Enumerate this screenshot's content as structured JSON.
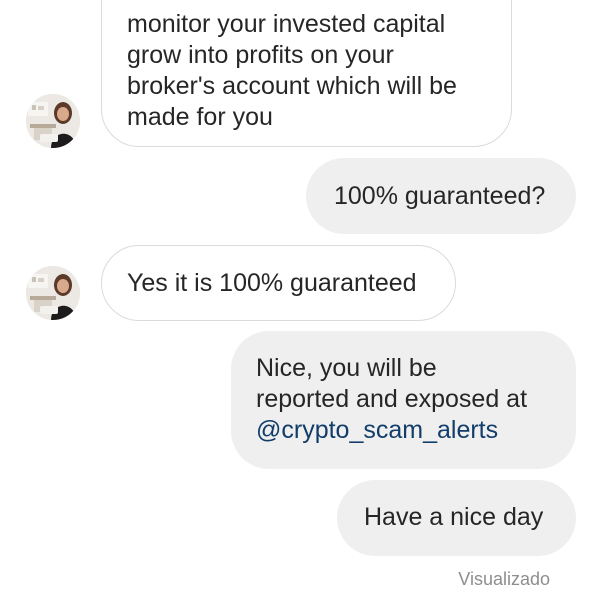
{
  "messages": [
    {
      "side": "incoming",
      "lines": [
        "monitor your invested capital",
        "grow into profits on your",
        "broker's account which will be",
        "made for you"
      ]
    },
    {
      "side": "outgoing",
      "text": "100% guaranteed?"
    },
    {
      "side": "incoming",
      "text": "Yes it is 100% guaranteed"
    },
    {
      "side": "outgoing",
      "lines": [
        "Nice, you will be",
        "reported and exposed at"
      ],
      "mention": "@crypto_scam_alerts"
    },
    {
      "side": "outgoing",
      "text": "Have a nice day"
    }
  ],
  "status": {
    "seen_label": "Visualizado"
  },
  "colors": {
    "incoming_bg": "#ffffff",
    "incoming_border": "#dbdbdb",
    "outgoing_bg": "#efefef",
    "text": "#262626",
    "mention": "#123d6a",
    "seen": "#8e8e8e"
  },
  "avatar": {
    "icon": "profile-photo-icon"
  }
}
